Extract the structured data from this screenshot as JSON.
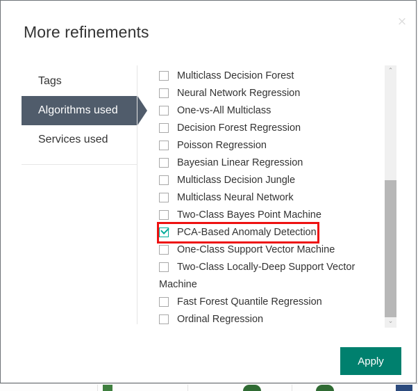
{
  "dialog": {
    "title": "More refinements",
    "close_label": "×",
    "close_icon": "close-icon"
  },
  "tabs": [
    {
      "label": "Tags",
      "selected": false
    },
    {
      "label": "Algorithms used",
      "selected": true
    },
    {
      "label": "Services used",
      "selected": false
    }
  ],
  "filters": {
    "items": [
      {
        "label": "Multiclass Decision Forest",
        "checked": false,
        "highlighted": false
      },
      {
        "label": "Neural Network Regression",
        "checked": false,
        "highlighted": false
      },
      {
        "label": "One-vs-All Multiclass",
        "checked": false,
        "highlighted": false
      },
      {
        "label": "Decision Forest Regression",
        "checked": false,
        "highlighted": false
      },
      {
        "label": "Poisson Regression",
        "checked": false,
        "highlighted": false
      },
      {
        "label": "Bayesian Linear Regression",
        "checked": false,
        "highlighted": false
      },
      {
        "label": "Multiclass Decision Jungle",
        "checked": false,
        "highlighted": false
      },
      {
        "label": "Multiclass Neural Network",
        "checked": false,
        "highlighted": false
      },
      {
        "label": "Two-Class Bayes Point Machine",
        "checked": false,
        "highlighted": false
      },
      {
        "label": "PCA-Based Anomaly Detection",
        "checked": true,
        "highlighted": true
      },
      {
        "label": "One-Class Support Vector Machine",
        "checked": false,
        "highlighted": false
      },
      {
        "label": "Two-Class Locally-Deep Support Vector Machine",
        "checked": false,
        "highlighted": false
      },
      {
        "label": "Fast Forest Quantile Regression",
        "checked": false,
        "highlighted": false
      },
      {
        "label": "Ordinal Regression",
        "checked": false,
        "highlighted": false
      }
    ]
  },
  "scrollbar": {
    "up_arrow_icon": "chevron-up-icon",
    "down_arrow_icon": "chevron-down-icon",
    "up_arrow_glyph": "⌃",
    "down_arrow_glyph": "⌄"
  },
  "footer": {
    "apply_label": "Apply"
  },
  "colors": {
    "selected_tab_bg": "#505c6b",
    "apply_button_bg": "#00806e",
    "checkbox_checked": "#00ab9a",
    "highlight_outline": "#ee1111",
    "dialog_border": "#6e7378",
    "text": "#333333"
  }
}
